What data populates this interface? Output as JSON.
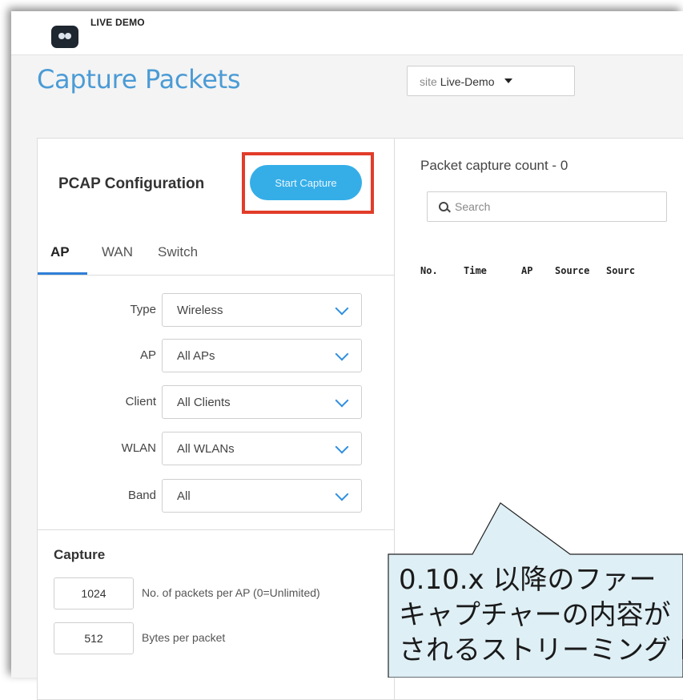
{
  "header": {
    "brand": "LIVE DEMO"
  },
  "page": {
    "title": "Capture Packets",
    "site_label": "site",
    "site_value": "Live-Demo"
  },
  "pcap": {
    "title": "PCAP Configuration",
    "start_button": "Start Capture",
    "tabs": [
      {
        "label": "AP",
        "active": true
      },
      {
        "label": "WAN",
        "active": false
      },
      {
        "label": "Switch",
        "active": false
      }
    ],
    "fields": [
      {
        "label": "Type",
        "value": "Wireless"
      },
      {
        "label": "AP",
        "value": "All APs"
      },
      {
        "label": "Client",
        "value": "All Clients"
      },
      {
        "label": "WLAN",
        "value": "All WLANs"
      },
      {
        "label": "Band",
        "value": "All"
      }
    ],
    "capture": {
      "title": "Capture",
      "packets_per_ap": {
        "value": "1024",
        "label": "No. of packets per AP (0=Unlimited)"
      },
      "bytes_per_packet": {
        "value": "512",
        "label": "Bytes per packet"
      }
    }
  },
  "results": {
    "count_text": "Packet capture count - 0",
    "search_placeholder": "Search",
    "columns": [
      "No.",
      "Time",
      "AP",
      "Source",
      "Sourc"
    ]
  },
  "callout": {
    "lines": [
      "0.10.x 以降のファー",
      "キャプチャーの内容が",
      "されるストリーミング P"
    ]
  },
  "colors": {
    "accent": "#35aee8",
    "title": "#4b9bd5",
    "highlight": "#e23c2a",
    "callout_bg": "#deeff5"
  }
}
